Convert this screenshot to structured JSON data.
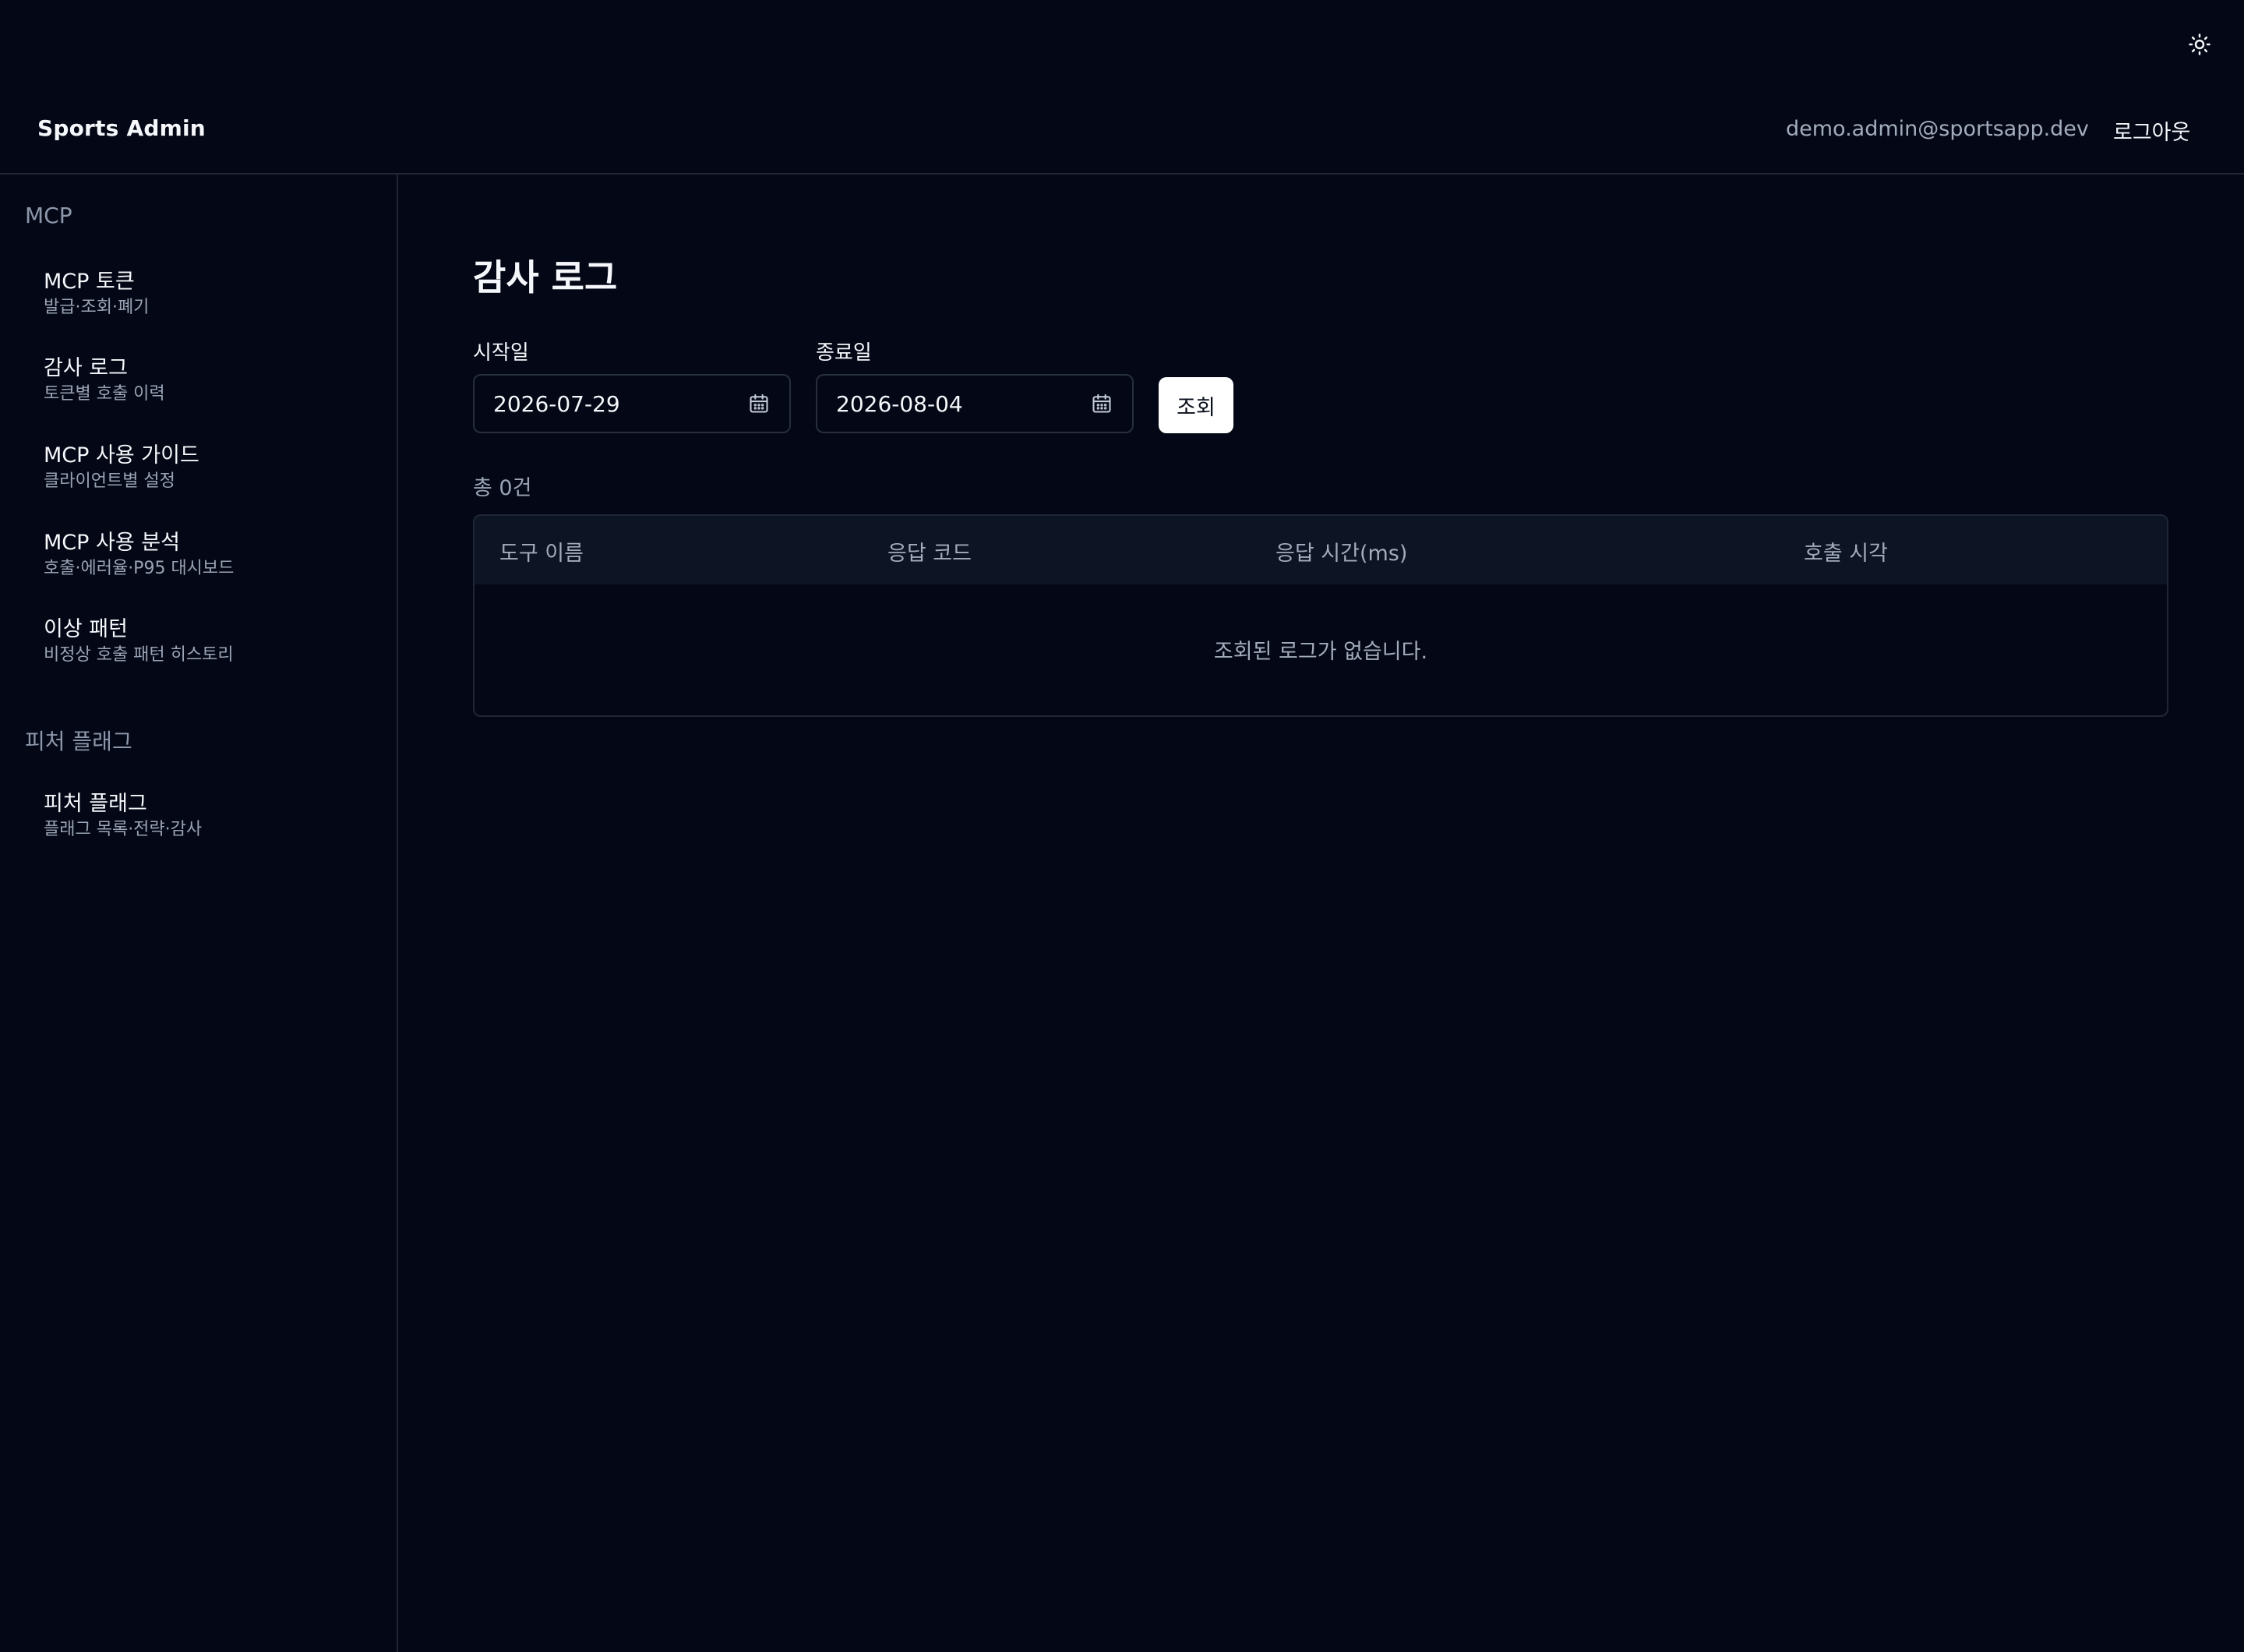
{
  "theme_toggle": {
    "icon": "sun-icon"
  },
  "header": {
    "brand": "Sports Admin",
    "user_email": "demo.admin@sportsapp.dev",
    "logout_label": "로그아웃"
  },
  "sidebar": {
    "sections": [
      {
        "title": "MCP",
        "items": [
          {
            "label": "MCP 토큰",
            "desc": "발급·조회·폐기"
          },
          {
            "label": "감사 로그",
            "desc": "토큰별 호출 이력"
          },
          {
            "label": "MCP 사용 가이드",
            "desc": "클라이언트별 설정"
          },
          {
            "label": "MCP 사용 분석",
            "desc": "호출·에러율·P95 대시보드"
          },
          {
            "label": "이상 패턴",
            "desc": "비정상 호출 패턴 히스토리"
          }
        ]
      },
      {
        "title": "피처 플래그",
        "items": [
          {
            "label": "피처 플래그",
            "desc": "플래그 목록·전략·감사"
          }
        ]
      }
    ]
  },
  "main": {
    "title": "감사 로그",
    "filters": {
      "start_label": "시작일",
      "start_value": "2026-07-29",
      "end_label": "종료일",
      "end_value": "2026-08-04",
      "search_label": "조회"
    },
    "total": "총 0건",
    "table": {
      "columns": [
        "도구 이름",
        "응답 코드",
        "응답 시간(ms)",
        "호출 시각"
      ],
      "empty_message": "조회된 로그가 없습니다."
    }
  }
}
